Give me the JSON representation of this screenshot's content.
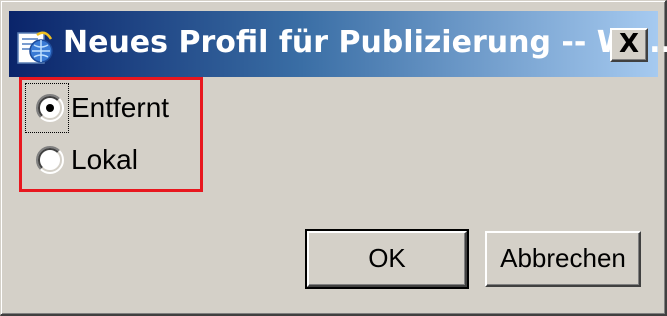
{
  "window": {
    "title": "Neues Profil für Publizierung -- We...",
    "close_label": "X",
    "icon": "publish-web-icon"
  },
  "options": [
    {
      "label": "Entfernt",
      "selected": true
    },
    {
      "label": "Lokal",
      "selected": false
    }
  ],
  "buttons": {
    "ok_label": "OK",
    "cancel_label": "Abbrechen"
  },
  "colors": {
    "highlight": "#e8171f",
    "dialog_bg": "#d4d0c8",
    "titlebar_start": "#0a246a",
    "titlebar_end": "#a6caf0"
  }
}
